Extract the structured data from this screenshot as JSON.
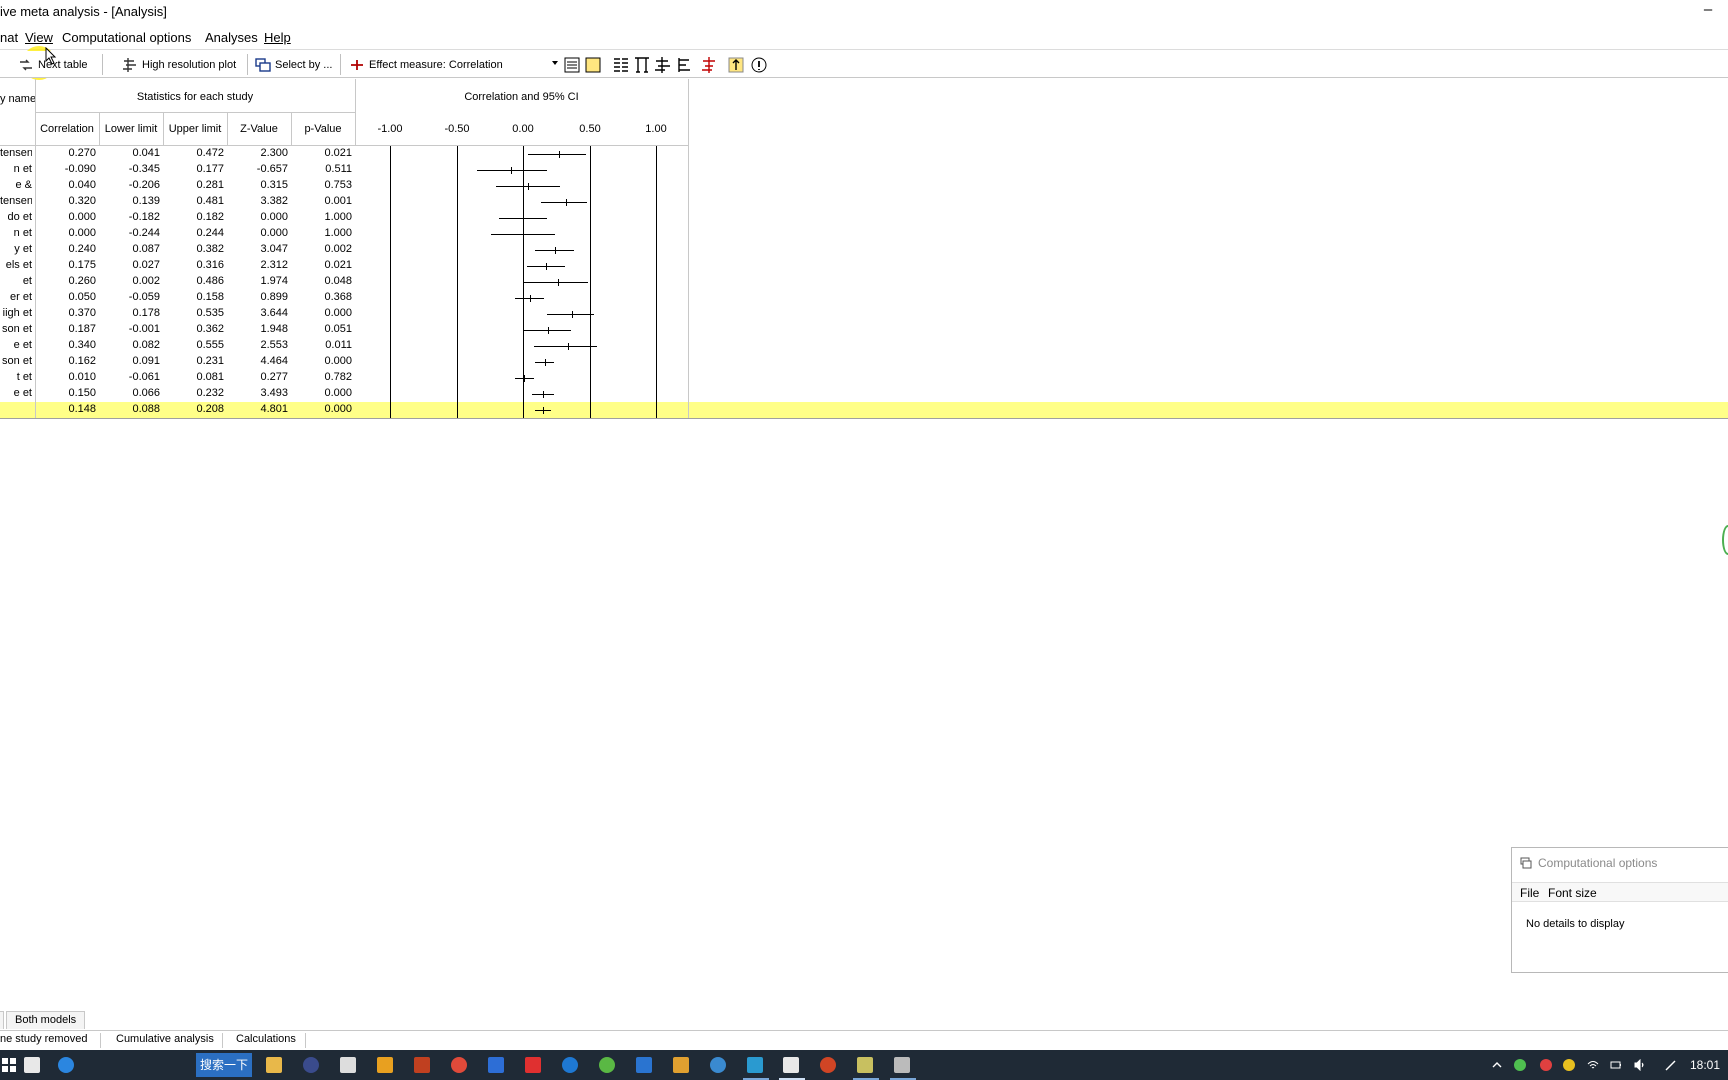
{
  "window": {
    "title": "ive meta analysis - [Analysis]",
    "minimize_glyph": "–"
  },
  "menu": {
    "items": [
      "nat",
      "View",
      "Computational options",
      "Analyses",
      "Help"
    ]
  },
  "toolbar": {
    "next_table": "Next table",
    "high_res_plot": "High resolution plot",
    "select_by": "Select by ...",
    "effect_measure": "Effect measure:  Correlation"
  },
  "grid": {
    "name_header": "y name",
    "stats_group_header": "Statistics for each study",
    "plot_group_header": "Correlation and 95% CI",
    "columns": [
      "Correlation",
      "Lower limit",
      "Upper limit",
      "Z-Value",
      "p-Value"
    ],
    "axis_ticks": [
      "-1.00",
      "-0.50",
      "0.00",
      "0.50",
      "1.00"
    ],
    "rows": [
      {
        "name": "tensen",
        "corr": "0.270",
        "lower": "0.041",
        "upper": "0.472",
        "z": "2.300",
        "p": "0.021"
      },
      {
        "name": "n et",
        "corr": "-0.090",
        "lower": "-0.345",
        "upper": "0.177",
        "z": "-0.657",
        "p": "0.511"
      },
      {
        "name": "e &",
        "corr": "0.040",
        "lower": "-0.206",
        "upper": "0.281",
        "z": "0.315",
        "p": "0.753"
      },
      {
        "name": "tensen",
        "corr": "0.320",
        "lower": "0.139",
        "upper": "0.481",
        "z": "3.382",
        "p": "0.001"
      },
      {
        "name": "do et",
        "corr": "0.000",
        "lower": "-0.182",
        "upper": "0.182",
        "z": "0.000",
        "p": "1.000"
      },
      {
        "name": "n et",
        "corr": "0.000",
        "lower": "-0.244",
        "upper": "0.244",
        "z": "0.000",
        "p": "1.000"
      },
      {
        "name": "y et",
        "corr": "0.240",
        "lower": "0.087",
        "upper": "0.382",
        "z": "3.047",
        "p": "0.002"
      },
      {
        "name": "els et",
        "corr": "0.175",
        "lower": "0.027",
        "upper": "0.316",
        "z": "2.312",
        "p": "0.021"
      },
      {
        "name": "et",
        "corr": "0.260",
        "lower": "0.002",
        "upper": "0.486",
        "z": "1.974",
        "p": "0.048"
      },
      {
        "name": "er et",
        "corr": "0.050",
        "lower": "-0.059",
        "upper": "0.158",
        "z": "0.899",
        "p": "0.368"
      },
      {
        "name": "iigh et",
        "corr": "0.370",
        "lower": "0.178",
        "upper": "0.535",
        "z": "3.644",
        "p": "0.000"
      },
      {
        "name": "son et",
        "corr": "0.187",
        "lower": "-0.001",
        "upper": "0.362",
        "z": "1.948",
        "p": "0.051"
      },
      {
        "name": "e et",
        "corr": "0.340",
        "lower": "0.082",
        "upper": "0.555",
        "z": "2.553",
        "p": "0.011"
      },
      {
        "name": "son et",
        "corr": "0.162",
        "lower": "0.091",
        "upper": "0.231",
        "z": "4.464",
        "p": "0.000"
      },
      {
        "name": "t et",
        "corr": "0.010",
        "lower": "-0.061",
        "upper": "0.081",
        "z": "0.277",
        "p": "0.782"
      },
      {
        "name": "e et",
        "corr": "0.150",
        "lower": "0.066",
        "upper": "0.232",
        "z": "3.493",
        "p": "0.000"
      }
    ],
    "summary": {
      "name": "",
      "corr": "0.148",
      "lower": "0.088",
      "upper": "0.208",
      "z": "4.801",
      "p": "0.000"
    }
  },
  "bottom_tabs": {
    "both_models": "Both models"
  },
  "status_tabs": [
    "ne study removed",
    "Cumulative analysis",
    "Calculations"
  ],
  "comp_panel": {
    "title": "Computational options",
    "menu": [
      "File",
      "Font size"
    ],
    "body": "No details to display"
  },
  "taskbar": {
    "search_label": "搜索一下",
    "clock": "18:01"
  },
  "colors": {
    "summary_row": "#ffff88",
    "taskbar": "#1f2a36",
    "highlight": "#ffeb00"
  }
}
